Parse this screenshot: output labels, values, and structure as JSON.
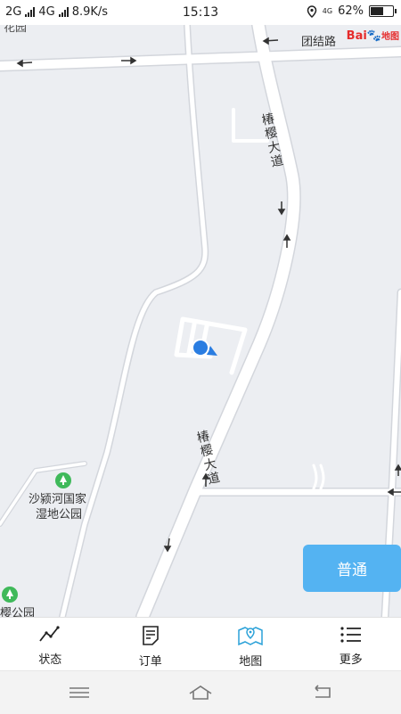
{
  "status_bar": {
    "network1": "2G",
    "network2": "4G",
    "speed": "8.9K/s",
    "time": "15:13",
    "network3": "4G",
    "battery": "62%",
    "battery_level": 0.62
  },
  "map": {
    "top_road_label": "团结路",
    "upper_left_label": "花园",
    "road_label_upper": "椿樱大道",
    "road_label_lower": "椿樱大道",
    "park_name_line1": "沙颍河国家",
    "park_name_line2": "湿地公园",
    "lower_left_label": "樱公园",
    "baidu_logo_text": "Bai",
    "baidu_logo_suffix": "地图"
  },
  "mode_button_label": "普通",
  "tabs": [
    {
      "label": "状态",
      "icon": "line-chart-icon"
    },
    {
      "label": "订单",
      "icon": "document-icon"
    },
    {
      "label": "地图",
      "icon": "map-icon"
    },
    {
      "label": "更多",
      "icon": "list-icon"
    }
  ],
  "active_tab": "地图",
  "colors": {
    "accent": "#54b3f2",
    "map_bg": "#eceef2",
    "road": "#ffffff",
    "location": "#2a7de1",
    "park_icon": "#3fb95a",
    "map_tab_icon": "#2aa1d8"
  }
}
